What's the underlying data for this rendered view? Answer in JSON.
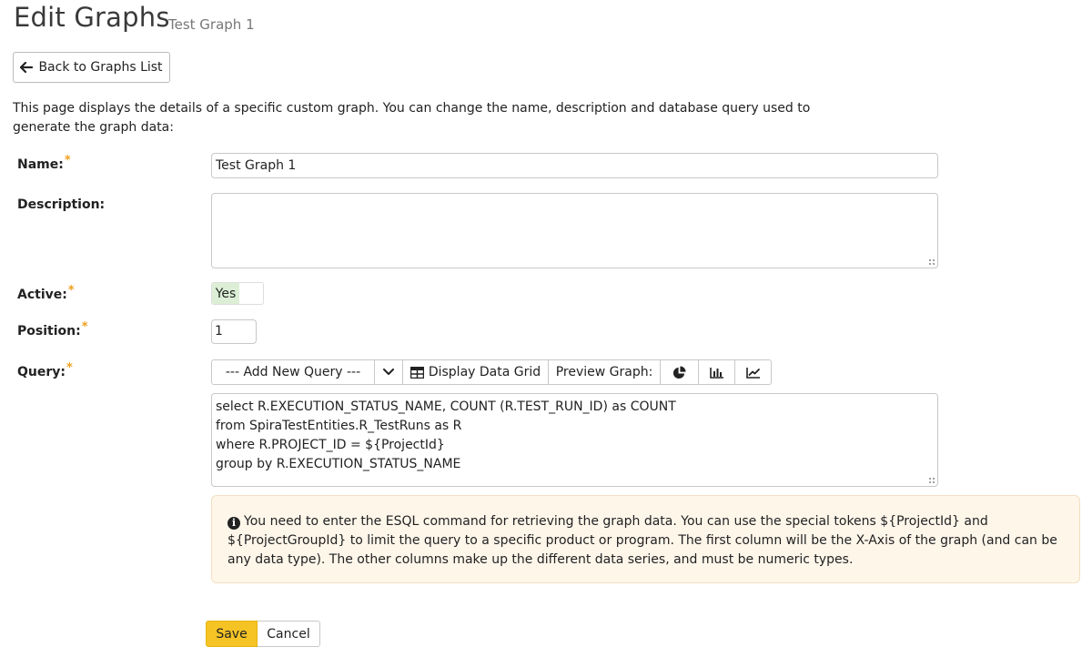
{
  "header": {
    "title": "Edit Graphs",
    "subtitle": "Test Graph 1"
  },
  "back_button": {
    "label": "Back to Graphs List",
    "icon": "arrow-left-icon"
  },
  "intro_text": "This page displays the details of a specific custom graph. You can change the name, description and database query used to generate the graph data:",
  "form": {
    "name": {
      "label": "Name:",
      "required_mark": "*",
      "value": "Test Graph 1"
    },
    "description": {
      "label": "Description:",
      "value": ""
    },
    "active": {
      "label": "Active:",
      "required_mark": "*",
      "value": "Yes"
    },
    "position": {
      "label": "Position:",
      "required_mark": "*",
      "value": "1"
    },
    "query": {
      "label": "Query:",
      "required_mark": "*",
      "toolbar": {
        "add_query_select": "--- Add New Query ---",
        "display_grid_label": "Display Data Grid",
        "preview_label": "Preview Graph:",
        "preview_icons": [
          "pie-chart-icon",
          "bar-chart-icon",
          "line-chart-icon"
        ]
      },
      "value": "select R.EXECUTION_STATUS_NAME, COUNT (R.TEST_RUN_ID) as COUNT\nfrom SpiraTestEntities.R_TestRuns as R\nwhere R.PROJECT_ID = ${ProjectId}\ngroup by R.EXECUTION_STATUS_NAME"
    }
  },
  "info_message": "You need to enter the ESQL command for retrieving the graph data. You can use the special tokens ${ProjectId} and ${ProjectGroupId} to limit the query to a specific product or program. The first column will be the X-Axis of the graph (and can be any data type). The other columns make up the different data series, and must be numeric types.",
  "buttons": {
    "save": "Save",
    "cancel": "Cancel"
  },
  "colors": {
    "save_button": "#f5c324",
    "required_star": "#f0a020",
    "toggle_on": "#dcefd6",
    "info_background": "#fff6ea"
  }
}
